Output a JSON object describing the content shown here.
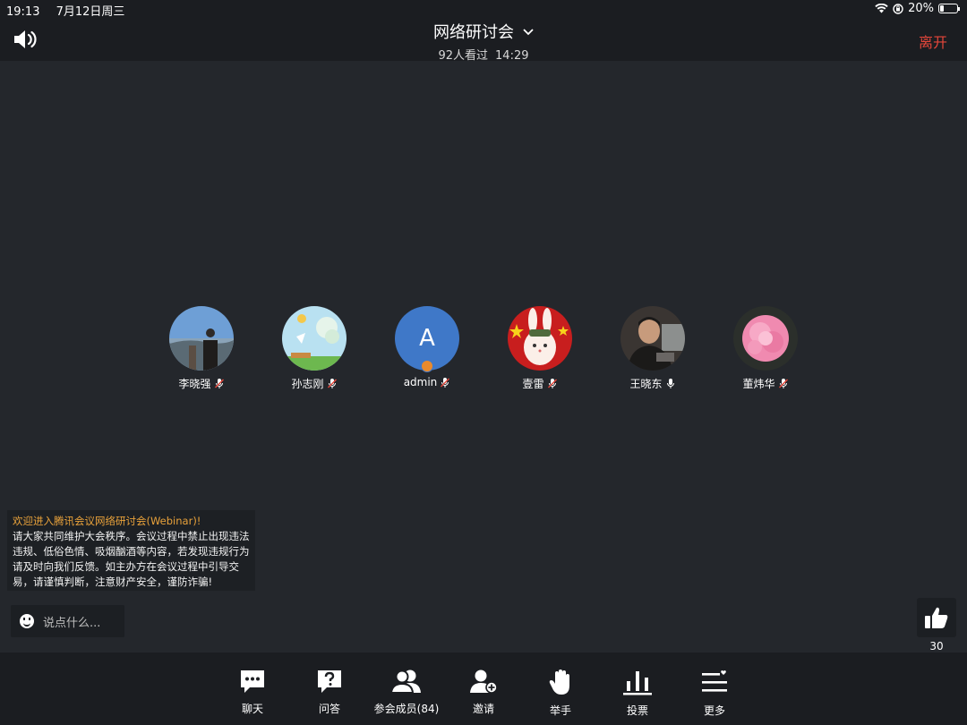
{
  "status_bar": {
    "time": "19:13",
    "date": "7月12日周三",
    "battery": "20%"
  },
  "header": {
    "title": "网络研讨会",
    "viewers": "92人看过",
    "duration": "14:29",
    "leave_label": "离开"
  },
  "participants": [
    {
      "name": "李晓强",
      "avatar": "photo-landscape",
      "mic": "muted"
    },
    {
      "name": "孙志刚",
      "avatar": "cartoon-scene",
      "mic": "muted"
    },
    {
      "name": "admin",
      "avatar_letter": "A",
      "mic": "muted",
      "host": true
    },
    {
      "name": "壹雷",
      "avatar": "rabbit-flag",
      "mic": "muted"
    },
    {
      "name": "王晓东",
      "avatar": "photo-person",
      "mic": "on"
    },
    {
      "name": "董炜华",
      "avatar": "pink-flower",
      "mic": "muted"
    }
  ],
  "notice": {
    "welcome": "欢迎进入腾讯会议网络研讨会(Webinar)!",
    "body": "请大家共同维护大会秩序。会议过程中禁止出现违法违规、低俗色情、吸烟酗酒等内容，若发现违规行为请及时向我们反馈。如主办方在会议过程中引导交易，请谨慎判断，注意财产安全，谨防诈骗!"
  },
  "chat": {
    "placeholder": "说点什么..."
  },
  "likes": {
    "count": "30"
  },
  "toolbar": {
    "items": [
      {
        "label": "聊天",
        "icon": "chat-icon"
      },
      {
        "label": "问答",
        "icon": "qa-icon"
      },
      {
        "label": "参会成员(84)",
        "icon": "members-icon"
      },
      {
        "label": "邀请",
        "icon": "invite-icon"
      },
      {
        "label": "举手",
        "icon": "raise-hand-icon"
      },
      {
        "label": "投票",
        "icon": "vote-icon"
      },
      {
        "label": "更多",
        "icon": "more-icon"
      }
    ]
  },
  "colors": {
    "background": "#24272c",
    "bar": "#1b1d21",
    "leave": "#e5463a",
    "welcome": "#e9a23b",
    "host_avatar": "#3f78c8"
  }
}
